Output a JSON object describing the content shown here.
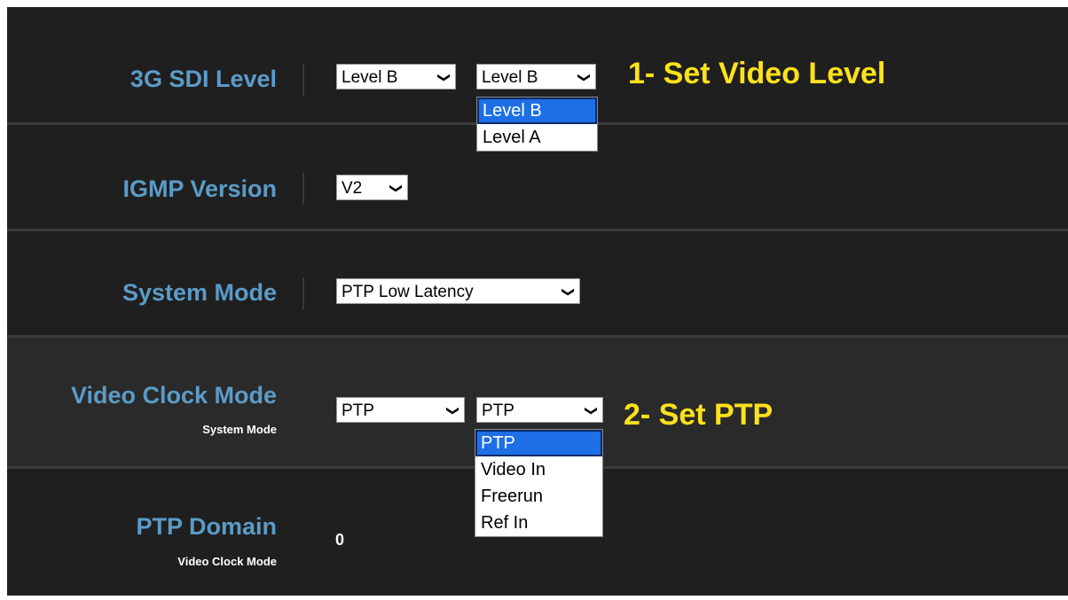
{
  "rows": {
    "sdi": {
      "label": "3G SDI Level",
      "select1_value": "Level B",
      "select2_value": "Level B",
      "annotation": "1- Set Video Level",
      "dropdown_options": [
        "Level B",
        "Level A"
      ]
    },
    "igmp": {
      "label": "IGMP Version",
      "select_value": "V2"
    },
    "system_mode": {
      "label": "System Mode",
      "select_value": "PTP Low Latency"
    },
    "video_clock": {
      "label": "Video Clock Mode",
      "sublabel": "System Mode",
      "select1_value": "PTP",
      "select2_value": "PTP",
      "annotation": "2- Set PTP",
      "dropdown_options": [
        "PTP",
        "Video In",
        "Freerun",
        "Ref In"
      ]
    },
    "ptp_domain": {
      "label": "PTP Domain",
      "sublabel": "Video Clock Mode",
      "value": "0"
    }
  },
  "colors": {
    "label_blue": "#5b9bc8",
    "annotation_yellow": "#ffe21a",
    "selected_option": "#1e6fe6"
  },
  "icons": {
    "chevron": "chevron-down-icon"
  }
}
